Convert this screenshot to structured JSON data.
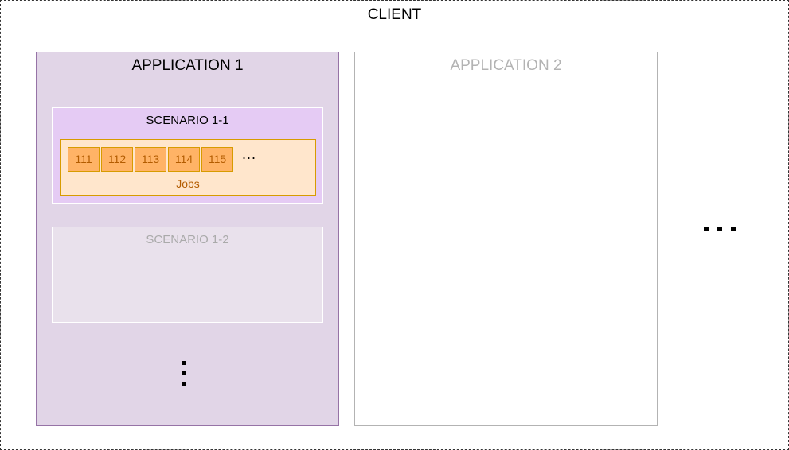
{
  "client": {
    "title": "CLIENT"
  },
  "applications": [
    {
      "title": "APPLICATION 1",
      "scenarios": [
        {
          "title": "SCENARIO 1-1",
          "jobs": {
            "items": [
              "111",
              "112",
              "113",
              "114",
              "115"
            ],
            "more": "...",
            "label": "Jobs"
          }
        },
        {
          "title": "SCENARIO 1-2"
        }
      ]
    },
    {
      "title": "APPLICATION 2"
    }
  ],
  "colors": {
    "app1_fill": "#e1d5e7",
    "app1_stroke": "#9673a6",
    "scenario_active_fill": "#e5cbf4",
    "scenario_inactive_fill": "#e9e1ec",
    "jobs_fill": "#ffe6cc",
    "job_fill": "#ffb366",
    "job_stroke": "#d79b00",
    "inactive_text": "#b3b3b3"
  }
}
